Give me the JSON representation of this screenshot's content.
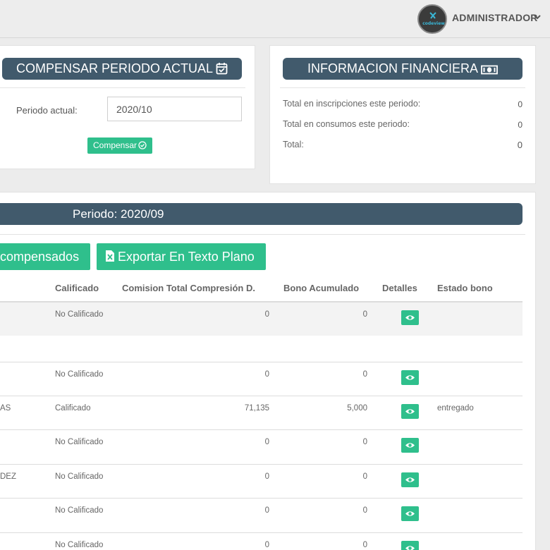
{
  "header": {
    "user_name": "ADMINISTRADOR",
    "logo_text": "codeview",
    "icons": [
      "user-logo-icon",
      "chevron-down-icon"
    ]
  },
  "compensar": {
    "title": "COMPENSAR PERIODO ACTUAL",
    "title_icon": "calendar-check-icon",
    "period_label": "Periodo actual:",
    "period_value": "2020/10",
    "button_label": "Compensar",
    "button_icon": "check-circle-icon"
  },
  "finanzas": {
    "title": "INFORMACION FINANCIERA",
    "title_icon": "money-bill-icon",
    "rows": [
      {
        "label": "Total en inscripciones este periodo:",
        "value": "0"
      },
      {
        "label": "Total en consumos este periodo:",
        "value": "0"
      },
      {
        "label": "Total:",
        "value": "0"
      }
    ]
  },
  "periodo": {
    "title": "Periodo: 2020/09",
    "compensados_button": "compensados",
    "export_button": "Exportar En Texto Plano",
    "export_icon": "file-excel-icon",
    "columns": [
      "Calificado",
      "Comision Total Compresión D.",
      "Bono Acumulado",
      "Detalles",
      "Estado bono"
    ],
    "rows": [
      {
        "name": "",
        "calificado": "No Calificado",
        "comision": "0",
        "bono": "0",
        "estado": ""
      },
      {
        "name": "",
        "calificado": "No Calificado",
        "comision": "0",
        "bono": "0",
        "estado": ""
      },
      {
        "name": "AS",
        "calificado": "Calificado",
        "comision": "71,135",
        "bono": "5,000",
        "estado": "entregado"
      },
      {
        "name": "",
        "calificado": "No Calificado",
        "comision": "0",
        "bono": "0",
        "estado": ""
      },
      {
        "name": "DEZ",
        "calificado": "No Calificado",
        "comision": "0",
        "bono": "0",
        "estado": ""
      },
      {
        "name": "",
        "calificado": "No Calificado",
        "comision": "0",
        "bono": "0",
        "estado": ""
      },
      {
        "name": "",
        "calificado": "No Calificado",
        "comision": "0",
        "bono": "0",
        "estado": ""
      }
    ]
  },
  "colors": {
    "accent": "#2fbf8c",
    "title_bar": "#415a6c"
  }
}
